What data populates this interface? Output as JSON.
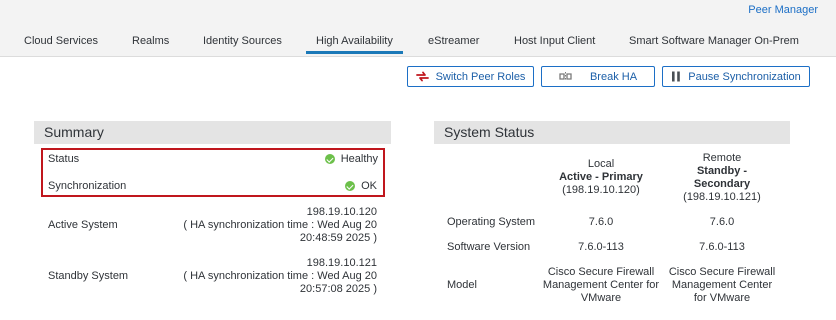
{
  "header": {
    "peer_manager": "Peer Manager",
    "tabs": [
      {
        "label": "Cloud Services"
      },
      {
        "label": "Realms"
      },
      {
        "label": "Identity Sources"
      },
      {
        "label": "High Availability",
        "active": true
      },
      {
        "label": "eStreamer"
      },
      {
        "label": "Host Input Client"
      },
      {
        "label": "Smart Software Manager On-Prem"
      }
    ]
  },
  "actions": {
    "switch_peer_roles": "Switch Peer Roles",
    "break_ha": "Break HA",
    "pause_sync": "Pause Synchronization"
  },
  "summary": {
    "title": "Summary",
    "status_label": "Status",
    "status_value": "Healthy",
    "sync_label": "Synchronization",
    "sync_value": "OK",
    "active_label": "Active System",
    "active_ip": "198.19.10.120",
    "active_sync_line1": "( HA synchronization time : Wed Aug 20",
    "active_sync_line2": "20:48:59 2025 )",
    "standby_label": "Standby System",
    "standby_ip": "198.19.10.121",
    "standby_sync_line1": "( HA synchronization time : Wed Aug 20",
    "standby_sync_line2": "20:57:08 2025 )"
  },
  "system_status": {
    "title": "System Status",
    "local": {
      "heading": "Local",
      "role": "Active - Primary",
      "ip": "(198.19.10.120)",
      "os": "7.6.0",
      "software": "7.6.0-113",
      "model_line1": "Cisco Secure Firewall",
      "model_line2": "Management Center for",
      "model_line3": "VMware"
    },
    "remote": {
      "heading": "Remote",
      "role_line1": "Standby -",
      "role_line2": "Secondary",
      "ip": "(198.19.10.121)",
      "os": "7.6.0",
      "software": "7.6.0-113",
      "model_line1": "Cisco Secure Firewall",
      "model_line2": "Management Center",
      "model_line3": "for VMware"
    },
    "rows": {
      "os_label": "Operating System",
      "software_label": "Software Version",
      "model_label": "Model"
    }
  },
  "colors": {
    "accent": "#1c6fc6",
    "highlight": "#c0161d",
    "ok": "#6cc04a"
  }
}
